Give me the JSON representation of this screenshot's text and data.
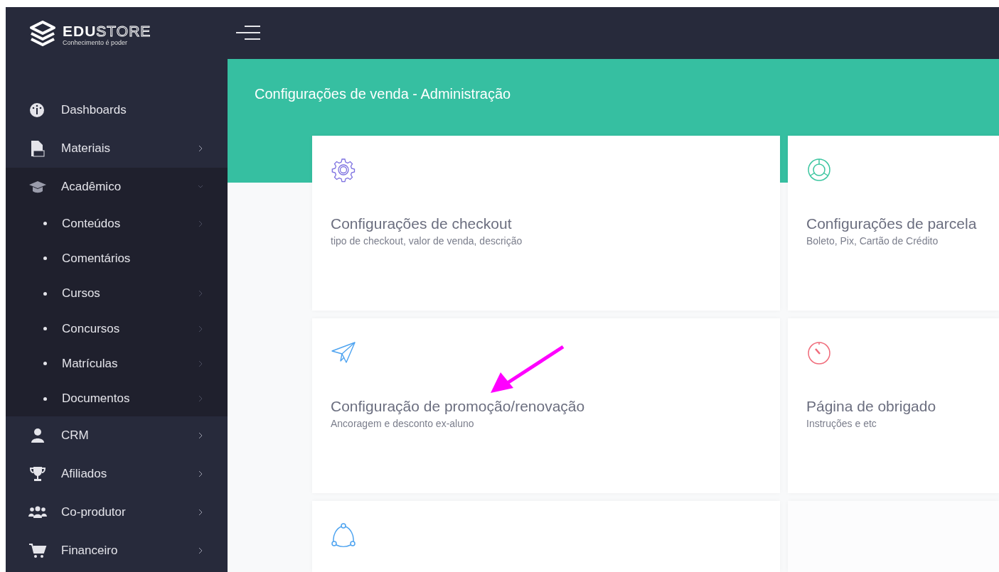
{
  "logo": {
    "brand_bold": "EDU",
    "brand_outline": "STORE",
    "tagline": "Conhecimento é poder"
  },
  "sidebar": {
    "items": [
      {
        "label": "Dashboards",
        "has_arrow": false,
        "expanded": false
      },
      {
        "label": "Materiais",
        "has_arrow": true,
        "expanded": false
      },
      {
        "label": "Acadêmico",
        "has_arrow": true,
        "expanded": true,
        "children": [
          {
            "label": "Conteúdos",
            "has_arrow": true
          },
          {
            "label": "Comentários",
            "has_arrow": false
          },
          {
            "label": "Cursos",
            "has_arrow": true
          },
          {
            "label": "Concursos",
            "has_arrow": true
          },
          {
            "label": "Matrículas",
            "has_arrow": true
          },
          {
            "label": "Documentos",
            "has_arrow": true
          }
        ]
      },
      {
        "label": "CRM",
        "has_arrow": true,
        "expanded": false
      },
      {
        "label": "Afiliados",
        "has_arrow": true,
        "expanded": false
      },
      {
        "label": "Co-produtor",
        "has_arrow": true,
        "expanded": false
      },
      {
        "label": "Financeiro",
        "has_arrow": true,
        "expanded": false
      }
    ]
  },
  "page": {
    "title": "Configurações de venda - Administração"
  },
  "cards": [
    {
      "kind": "setting",
      "title": "Configurações de checkout",
      "subtitle": "tipo de checkout, valor de venda, descrição",
      "color": "#7b6fe0"
    },
    {
      "kind": "setting",
      "title": "Configurações de parcela",
      "subtitle": "Boleto, Pix, Cartão de Crédito",
      "color": "#3cc6a0"
    },
    {
      "kind": "setting",
      "title": "Configuração de promoção/renovação",
      "subtitle": "Ancoragem e desconto ex-aluno",
      "color": "#4da3f0"
    },
    {
      "kind": "setting",
      "title": "Página de obrigado",
      "subtitle": "Instruções e etc",
      "color": "#f06b7a"
    },
    {
      "kind": "setting",
      "color": "#4da3f0"
    },
    {
      "kind": "empty"
    }
  ]
}
